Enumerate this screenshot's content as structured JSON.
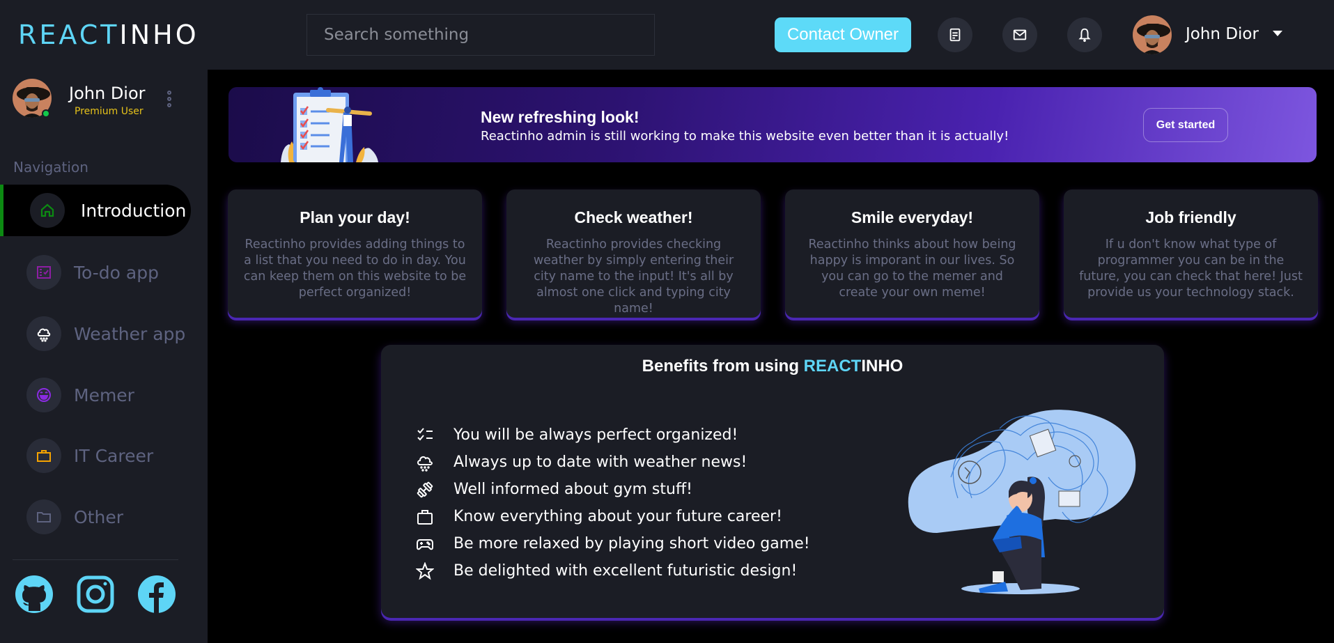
{
  "header": {
    "logo_part1": "REACT",
    "logo_part2": "INHO",
    "search_placeholder": "Search something",
    "contact_button": "Contact Owner",
    "icons": [
      "notes-icon",
      "mail-icon",
      "bell-icon"
    ],
    "user_name": "John Dior"
  },
  "sidebar": {
    "user_name": "John Dior",
    "user_role": "Premium User",
    "nav_title": "Navigation",
    "items": [
      {
        "label": "Introduction",
        "icon": "home-icon",
        "color": "#0c8a12",
        "active": true
      },
      {
        "label": "To-do app",
        "icon": "checklist-icon",
        "color": "#8d1ea3",
        "active": false
      },
      {
        "label": "Weather app",
        "icon": "cloud-rain-icon",
        "color": "#ffffff",
        "active": false
      },
      {
        "label": "Memer",
        "icon": "smile-icon",
        "color": "#8a2be2",
        "active": false
      },
      {
        "label": "IT Career",
        "icon": "briefcase-icon",
        "color": "#f5a300",
        "active": false
      },
      {
        "label": "Other",
        "icon": "folder-icon",
        "color": "#5e6380",
        "active": false
      }
    ],
    "social": [
      "github-icon",
      "instagram-icon",
      "facebook-icon"
    ]
  },
  "banner": {
    "title": "New refreshing look!",
    "text": "Reactinho admin is still working to make this website even better than it is actually!",
    "button": "Get started"
  },
  "cards": [
    {
      "title": "Plan your day!",
      "text": "Reactinho provides adding things to a list that you need to do in day. You can keep them on this website to be perfect organized!"
    },
    {
      "title": "Check weather!",
      "text": "Reactinho provides checking weather by simply entering their city name to the input! It's all by almost one click and typing city name!"
    },
    {
      "title": "Smile everyday!",
      "text": "Reactinho thinks about how being happy is imporant in our lives. So you can go to the memer and create your own meme!"
    },
    {
      "title": "Job friendly",
      "text": "If u don't know what type of programmer you can be in the future, you can check that here! Just provide us your technology stack."
    }
  ],
  "benefits": {
    "title_prefix": "Benefits from using ",
    "title_brand1": "REACT",
    "title_brand2": "INHO",
    "items": [
      {
        "icon": "checklist-icon",
        "text": "You will be always perfect organized!"
      },
      {
        "icon": "cloud-rain-icon",
        "text": "Always up to date with weather news!"
      },
      {
        "icon": "dumbbell-icon",
        "text": "Well informed about gym stuff!"
      },
      {
        "icon": "briefcase-icon",
        "text": "Know everything about your future career!"
      },
      {
        "icon": "gamepad-icon",
        "text": "Be more relaxed by playing short video game!"
      },
      {
        "icon": "star-icon",
        "text": "Be delighted with excellent futuristic design!"
      }
    ]
  },
  "colors": {
    "accent": "#5ed5f6",
    "card_glow": "#4a27b2",
    "panel": "#1b1d25",
    "muted": "#5e6380",
    "premium": "#e6c21a"
  }
}
